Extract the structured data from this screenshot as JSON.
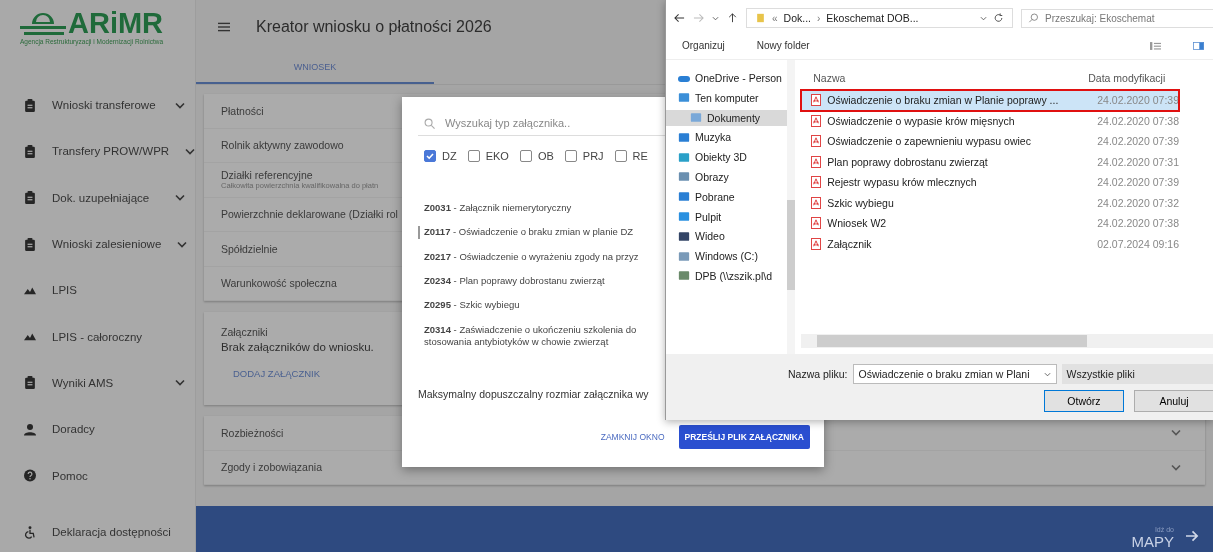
{
  "logo": {
    "text": "ARiMR",
    "subtitle": "Agencja Restrukturyzacji i Modernizacji Rolnictwa"
  },
  "sidebar": {
    "items": [
      {
        "label": "Wnioski transferowe",
        "kind": "clipboard",
        "expandable": true
      },
      {
        "label": "Transfery PROW/WPR",
        "kind": "clipboard",
        "expandable": true
      },
      {
        "label": "Dok. uzupełniające",
        "kind": "clipboard",
        "expandable": true
      },
      {
        "label": "Wnioski zalesieniowe",
        "kind": "clipboard",
        "expandable": true
      },
      {
        "label": "LPIS",
        "kind": "terrain",
        "expandable": false
      },
      {
        "label": "LPIS - całoroczny",
        "kind": "terrain",
        "expandable": false
      },
      {
        "label": "Wyniki AMS",
        "kind": "clipboard",
        "expandable": true
      },
      {
        "label": "Doradcy",
        "kind": "person",
        "expandable": false
      },
      {
        "label": "Pomoc",
        "kind": "help",
        "expandable": false
      }
    ],
    "footer": {
      "label": "Deklaracja dostępności",
      "kind": "accessibility"
    }
  },
  "header": {
    "title": "Kreator wniosku o płatności 2026"
  },
  "tabs": [
    {
      "label": "WNIOSEK",
      "selected": true
    }
  ],
  "panel_groups": [
    {
      "rows": [
        {
          "title": "Płatności"
        },
        {
          "title": "Rolnik aktywny zawodowo"
        },
        {
          "title": "Działki referencyjne",
          "subtitle": "Całkowita powierzchnia kwalifikowalna do płatn"
        },
        {
          "title": "Powierzchnie deklarowane (Działki rol"
        },
        {
          "title": "Spółdzielnie"
        },
        {
          "title": "Warunkowość społeczna"
        }
      ]
    },
    {
      "attachments": {
        "title": "Załączniki",
        "message": "Brak załączników do wniosku.",
        "button": "DODAJ ZAŁĄCZNIK"
      }
    },
    {
      "rows": [
        {
          "title": "Rozbieżności",
          "expandable": true
        },
        {
          "title": "Zgody i zobowiązania",
          "expandable": true
        }
      ]
    }
  ],
  "footer_bar": {
    "hint": "Idź do",
    "link": "MAPY"
  },
  "modal": {
    "search": {
      "placeholder": "Wyszukaj typ załącznika.."
    },
    "filters": [
      {
        "label": "DZ",
        "checked": true
      },
      {
        "label": "EKO",
        "checked": false
      },
      {
        "label": "OB",
        "checked": false
      },
      {
        "label": "PRJ",
        "checked": false
      },
      {
        "label": "RE",
        "checked": false
      }
    ],
    "items": [
      {
        "text": "**Z0031** - Załącznik niemerytoryczny",
        "highlighted": false
      },
      {
        "text": "**Z0117** - Oświadczenie o braku zmian w planie DZ",
        "highlighted": true
      },
      {
        "text": "**Z0217** - Oświadczenie o wyrażeniu zgody na przyz",
        "highlighted": false
      },
      {
        "text": "**Z0234** - Plan poprawy dobrostanu zwierząt",
        "highlighted": false
      },
      {
        "text": "**Z0295** - Szkic wybiegu",
        "highlighted": false
      },
      {
        "text": "**Z0314** - Zaświadczenie o ukończeniu szkolenia do stosowania antybiotyków w chowie zwierząt",
        "highlighted": false
      }
    ],
    "note": "Maksymalny dopuszczalny rozmiar załącznika wy",
    "buttons": [
      {
        "label": "ZAMKNIJ OKNO",
        "kind": "text"
      },
      {
        "label": "PRZEŚLIJ PLIK ZAŁĄCZNIKA",
        "kind": "primary"
      }
    ]
  },
  "file_dialog": {
    "path_overflow": "«",
    "path_separator": "›",
    "path": [
      "Dok...",
      "Ekoschemat DOB..."
    ],
    "search": {
      "placeholder": "Przeszukaj: Ekoschemat"
    },
    "toolbar": [
      "Organizuj",
      "Nowy folder"
    ],
    "nav": [
      {
        "label": "OneDrive - Person",
        "kind": "cloud",
        "selected": false
      },
      {
        "label": "Ten komputer",
        "kind": "computer",
        "selected": false
      },
      {
        "label": "Dokumenty",
        "kind": "documents",
        "selected": true
      },
      {
        "label": "Muzyka",
        "kind": "music",
        "selected": false
      },
      {
        "label": "Obiekty 3D",
        "kind": "cube",
        "selected": false
      },
      {
        "label": "Obrazy",
        "kind": "pictures",
        "selected": false
      },
      {
        "label": "Pobrane",
        "kind": "download",
        "selected": false
      },
      {
        "label": "Pulpit",
        "kind": "desktop",
        "selected": false
      },
      {
        "label": "Wideo",
        "kind": "video",
        "selected": false
      },
      {
        "label": "Windows (C:)",
        "kind": "drive",
        "selected": false
      },
      {
        "label": "DPB (\\\\zszik.pl\\d",
        "kind": "network",
        "selected": false
      }
    ],
    "columns": [
      "Nazwa",
      "Data modyfikacji"
    ],
    "files": [
      {
        "name": "Oświadczenie o braku zmian w Planie poprawy ...",
        "date": "24.02.2020 07:39",
        "selected": true,
        "marked": true
      },
      {
        "name": "Oświadczenie o wypasie krów mięsnych",
        "date": "24.02.2020 07:38",
        "selected": false,
        "marked": false
      },
      {
        "name": "Oświadczenie o zapewnieniu wypasu owiec",
        "date": "24.02.2020 07:39",
        "selected": false,
        "marked": false
      },
      {
        "name": "Plan poprawy dobrostanu zwierząt",
        "date": "24.02.2020 07:31",
        "selected": false,
        "marked": false
      },
      {
        "name": "Rejestr wypasu krów mlecznych",
        "date": "24.02.2020 07:39",
        "selected": false,
        "marked": false
      },
      {
        "name": "Szkic wybiegu",
        "date": "24.02.2020 07:32",
        "selected": false,
        "marked": false
      },
      {
        "name": "Wniosek W2",
        "date": "24.02.2020 07:38",
        "selected": false,
        "marked": false
      },
      {
        "name": "Załącznik",
        "date": "02.07.2024 09:16",
        "selected": false,
        "marked": false
      }
    ],
    "filename_label": "Nazwa pliku:",
    "filename": "Oświadczenie o braku zmian w Plani",
    "filetype": "Wszystkie pliki",
    "buttons": [
      "Otwórz",
      "Anuluj"
    ]
  }
}
